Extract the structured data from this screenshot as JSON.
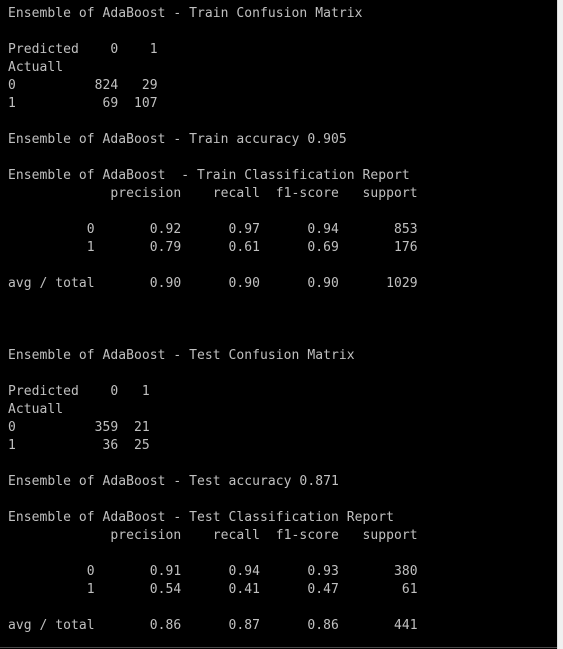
{
  "terminal": {
    "lines": [
      "Ensemble of AdaBoost - Train Confusion Matrix",
      "",
      "Predicted    0    1",
      "Actuall",
      "0          824   29",
      "1           69  107",
      "",
      "Ensemble of AdaBoost - Train accuracy 0.905",
      "",
      "Ensemble of AdaBoost  - Train Classification Report",
      "             precision    recall  f1-score   support",
      "",
      "          0       0.92      0.97      0.94       853",
      "          1       0.79      0.61      0.69       176",
      "",
      "avg / total       0.90      0.90      0.90      1029",
      "",
      "",
      "",
      "Ensemble of AdaBoost - Test Confusion Matrix",
      "",
      "Predicted    0   1",
      "Actuall",
      "0          359  21",
      "1           36  25",
      "",
      "Ensemble of AdaBoost - Test accuracy 0.871",
      "",
      "Ensemble of AdaBoost - Test Classification Report",
      "             precision    recall  f1-score   support",
      "",
      "          0       0.91      0.94      0.93       380",
      "          1       0.54      0.41      0.47        61",
      "",
      "avg / total       0.86      0.87      0.86       441"
    ]
  },
  "colors": {
    "background": "#000000",
    "text": "#c0c0c0",
    "scrollbar": "#f0f0f0"
  }
}
